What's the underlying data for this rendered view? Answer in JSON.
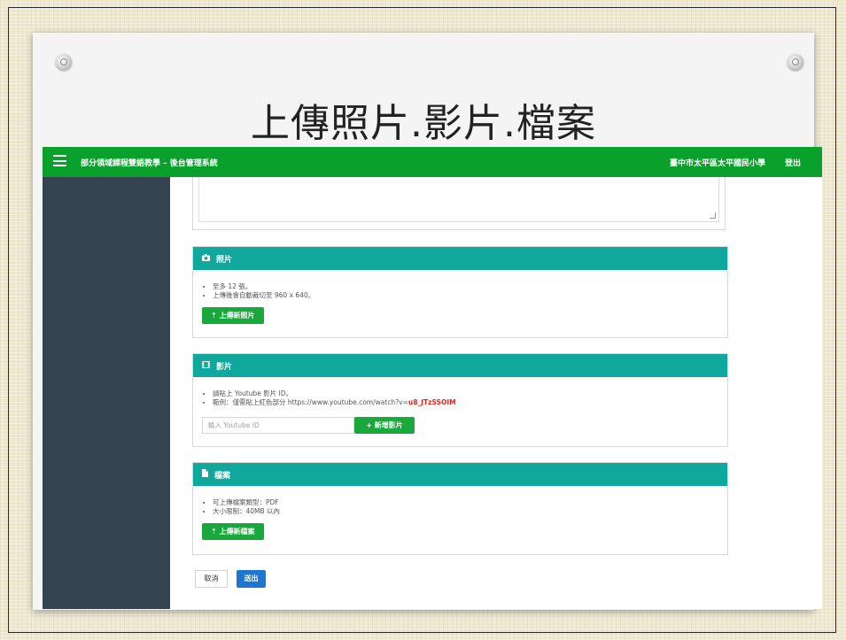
{
  "slide": {
    "title": "上傳照片.影片.檔案"
  },
  "header": {
    "app_title": "部分領域課程雙語教學 – 後台管理系統",
    "school": "臺中市太平區太平國民小學",
    "logout": "登出"
  },
  "photos": {
    "heading": "照片",
    "notes": [
      "至多 12 張。",
      "上傳後會自動裁切至 960 x 640。"
    ],
    "upload_label": "上傳新照片"
  },
  "videos": {
    "heading": "影片",
    "note1": "請貼上 Youtube 影片 ID。",
    "note2_prefix": "範例：僅需貼上紅色部分 https://www.youtube.com/watch?v=",
    "note2_highlight": "u8_JTzSSOIM",
    "input_placeholder": "輸入 Youtube ID",
    "add_label": "新增影片"
  },
  "files": {
    "heading": "檔案",
    "notes": [
      "可上傳檔案類型：PDF",
      "大小限制：40MB 以內"
    ],
    "upload_label": "上傳新檔案"
  },
  "actions": {
    "cancel": "取消",
    "submit": "送出"
  },
  "colors": {
    "topbar": "#0aa02c",
    "panel_header": "#10a89d",
    "sidebar": "#334350",
    "button_green": "#18a83b",
    "button_blue": "#1e76d0",
    "highlight_red": "#e2231a"
  },
  "icons": {
    "menu": "hamburger-icon",
    "photos": "camera-icon",
    "videos": "film-icon",
    "files": "file-icon",
    "upload": "upload-icon",
    "add": "plus-icon"
  }
}
